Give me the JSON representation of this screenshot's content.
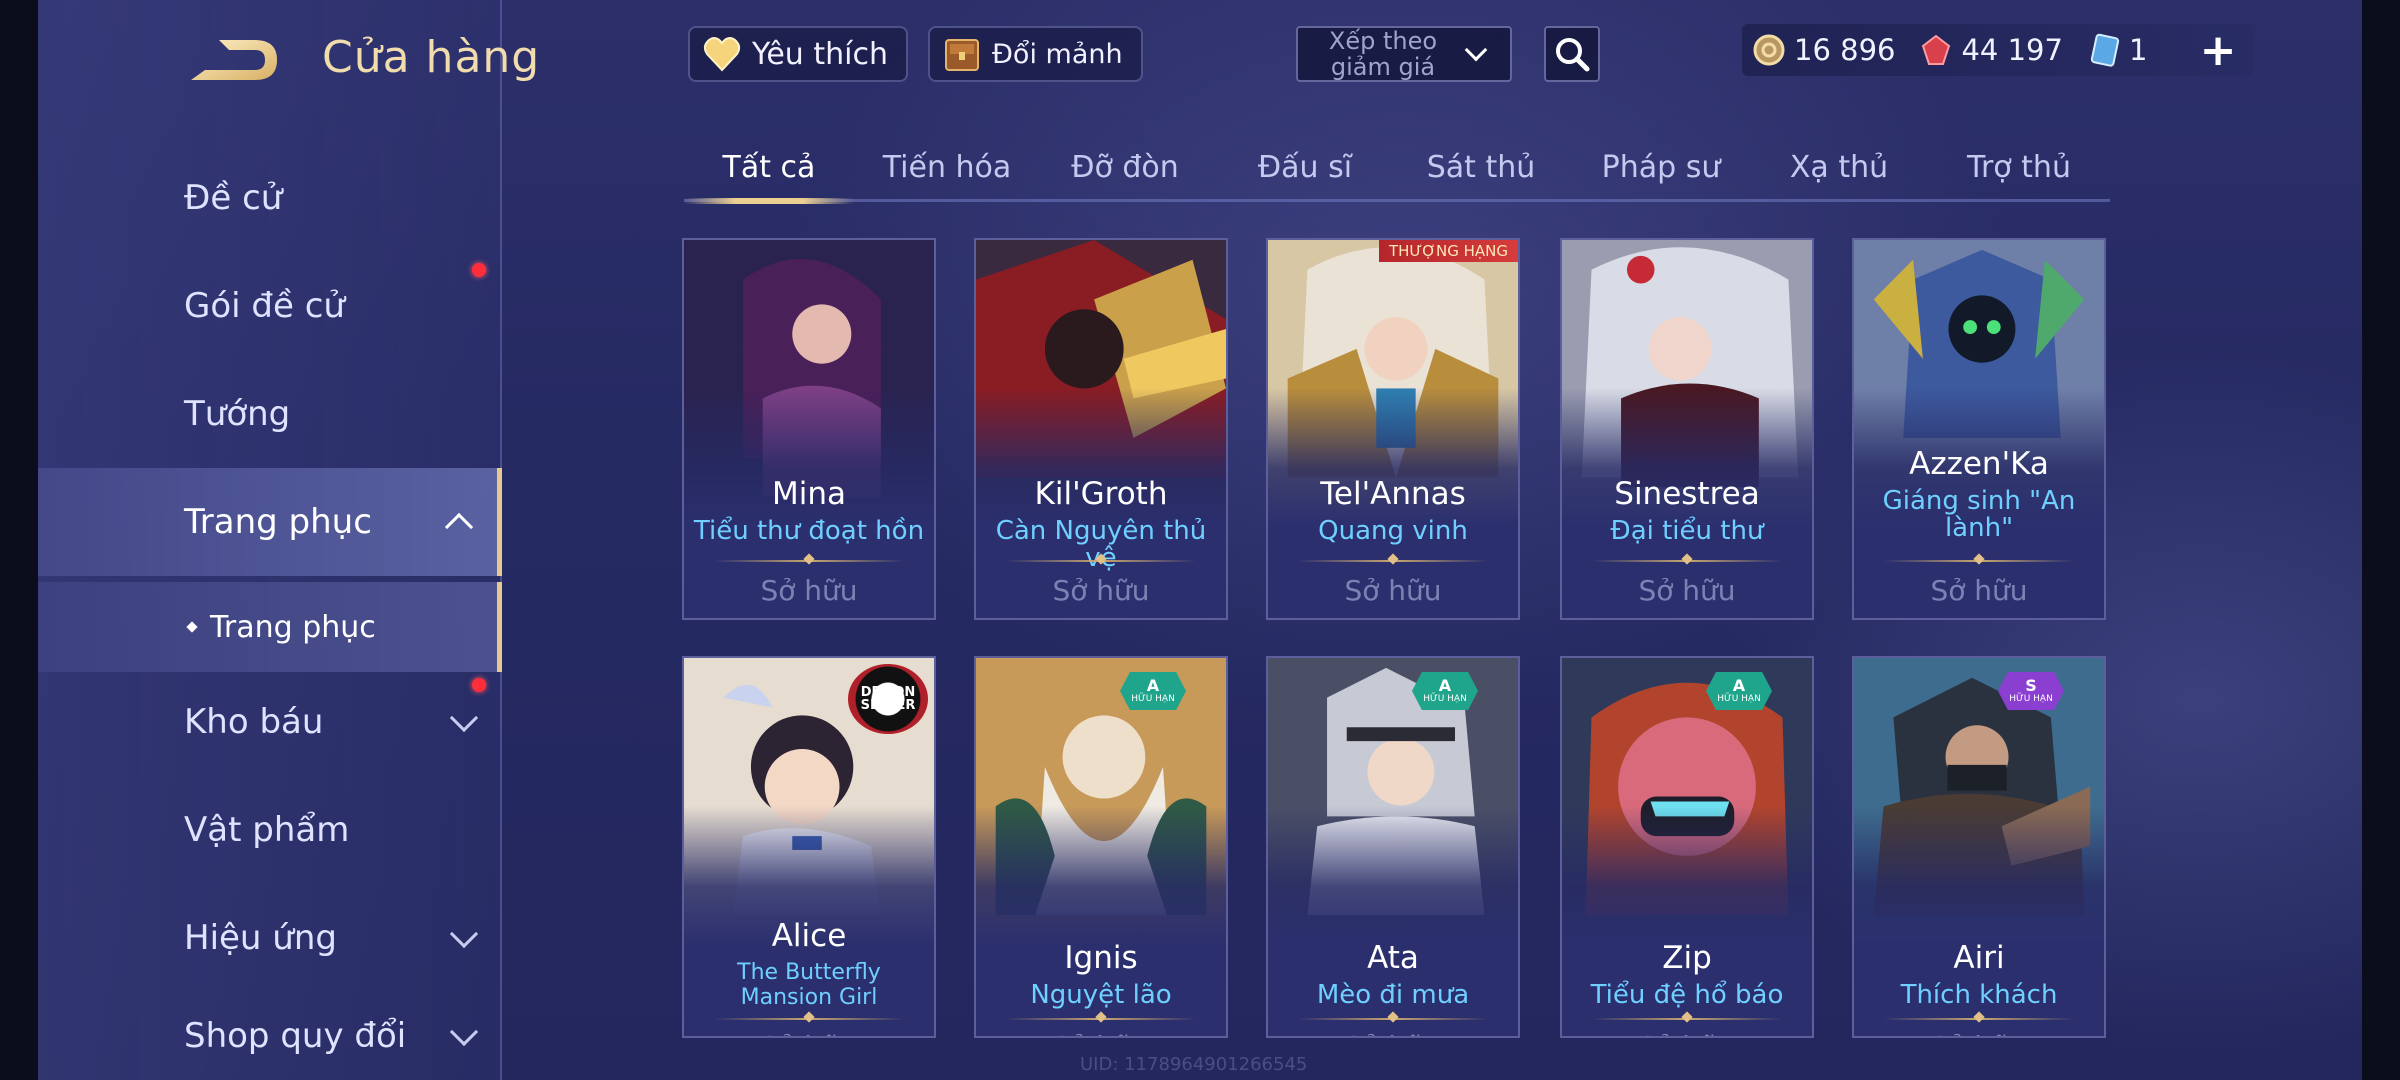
{
  "header": {
    "title": "Cửa hàng",
    "favorite_label": "Yêu thích",
    "exchange_label": "Đổi mảnh",
    "sort_label": "Xếp theo giảm giá",
    "currencies": [
      "16 896",
      "44 197",
      "1"
    ]
  },
  "sidebar": {
    "items": [
      {
        "label": "Đề cử"
      },
      {
        "label": "Gói đề cử"
      },
      {
        "label": "Tướng"
      },
      {
        "label": "Trang phục"
      },
      {
        "label": "Kho báu"
      },
      {
        "label": "Vật phẩm"
      },
      {
        "label": "Hiệu ứng"
      },
      {
        "label": "Shop quy đổi"
      }
    ],
    "sub_item": "Trang phục"
  },
  "tabs": [
    "Tất cả",
    "Tiến hóa",
    "Đỡ đòn",
    "Đấu sĩ",
    "Sát thủ",
    "Pháp sư",
    "Xạ thủ",
    "Trợ thủ"
  ],
  "cards": [
    {
      "hero": "Mina",
      "skin": "Tiểu thư đoạt hồn",
      "status": "Sở hữu"
    },
    {
      "hero": "Kil'Groth",
      "skin": "Càn Nguyên thủ vệ",
      "status": "Sở hữu"
    },
    {
      "hero": "Tel'Annas",
      "skin": "Quang vinh",
      "status": "Sở hữu",
      "tag": "THƯỢNG HẠNG"
    },
    {
      "hero": "Sinestrea",
      "skin": "Đại tiểu thư",
      "status": "Sở hữu"
    },
    {
      "hero": "Azzen'Ka",
      "skin": "Giáng sinh \"An lành\"",
      "status": "Sở hữu"
    },
    {
      "hero": "Alice",
      "skin": "The Butterfly Mansion Girl",
      "status": "Sở hữu",
      "brand": "DEMON SLAYER"
    },
    {
      "hero": "Ignis",
      "skin": "Nguyệt lão",
      "status": "Sở hữu",
      "tier": "A",
      "tier_sub": "HỮU HẠN"
    },
    {
      "hero": "Ata",
      "skin": "Mèo đi mưa",
      "status": "Sở hữu",
      "tier": "A",
      "tier_sub": "HỮU HẠN"
    },
    {
      "hero": "Zip",
      "skin": "Tiểu đệ hổ báo",
      "status": "Sở hữu",
      "tier": "A",
      "tier_sub": "HỮU HẠN"
    },
    {
      "hero": "Airi",
      "skin": "Thích khách",
      "status": "Sở hữu",
      "tier": "S",
      "tier_sub": "HỮU HẠN"
    }
  ],
  "footer": {
    "uid": "UID: 1178964901266545"
  },
  "colors": {
    "accent_gold": "#ebcf92",
    "skin_blue": "#6fd0ff",
    "notify_red": "#ff2d3a"
  }
}
